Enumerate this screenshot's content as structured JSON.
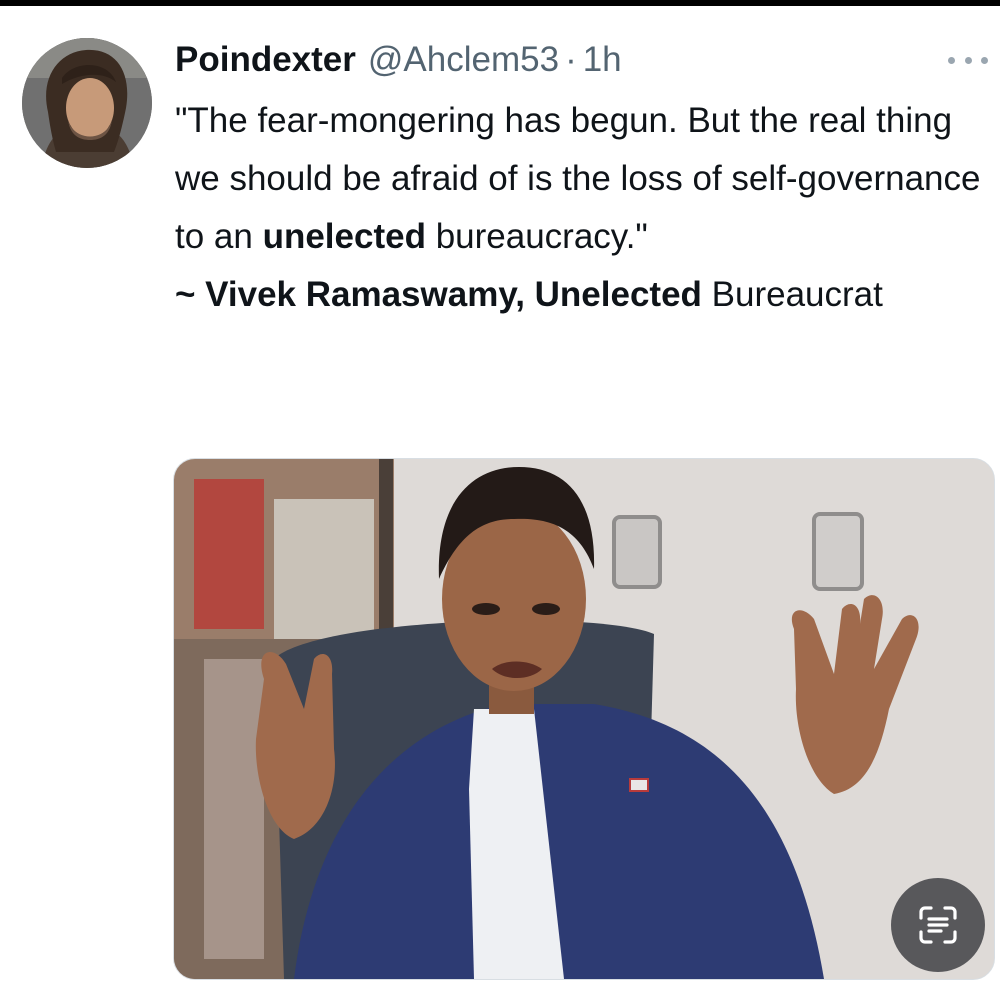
{
  "tweet": {
    "display_name": "Poindexter",
    "handle": "@Ahclem53",
    "separator": "·",
    "time": "1h",
    "text": {
      "line_a": "\"The fear-mongering has begun. But the real thing we should be afraid of is the loss of self-governance to an ",
      "bold_word": "unelected",
      "line_b": " bureaucracy.\"",
      "attribution_bold": "~ Vivek Ramaswamy, Unelected",
      "attribution_rest": " Bureaucrat"
    }
  },
  "icons": {
    "more": "more-horizontal-icon",
    "lens": "text-scan-icon"
  },
  "colors": {
    "text": "#0f1419",
    "secondary": "#536471",
    "background": "#ffffff"
  }
}
